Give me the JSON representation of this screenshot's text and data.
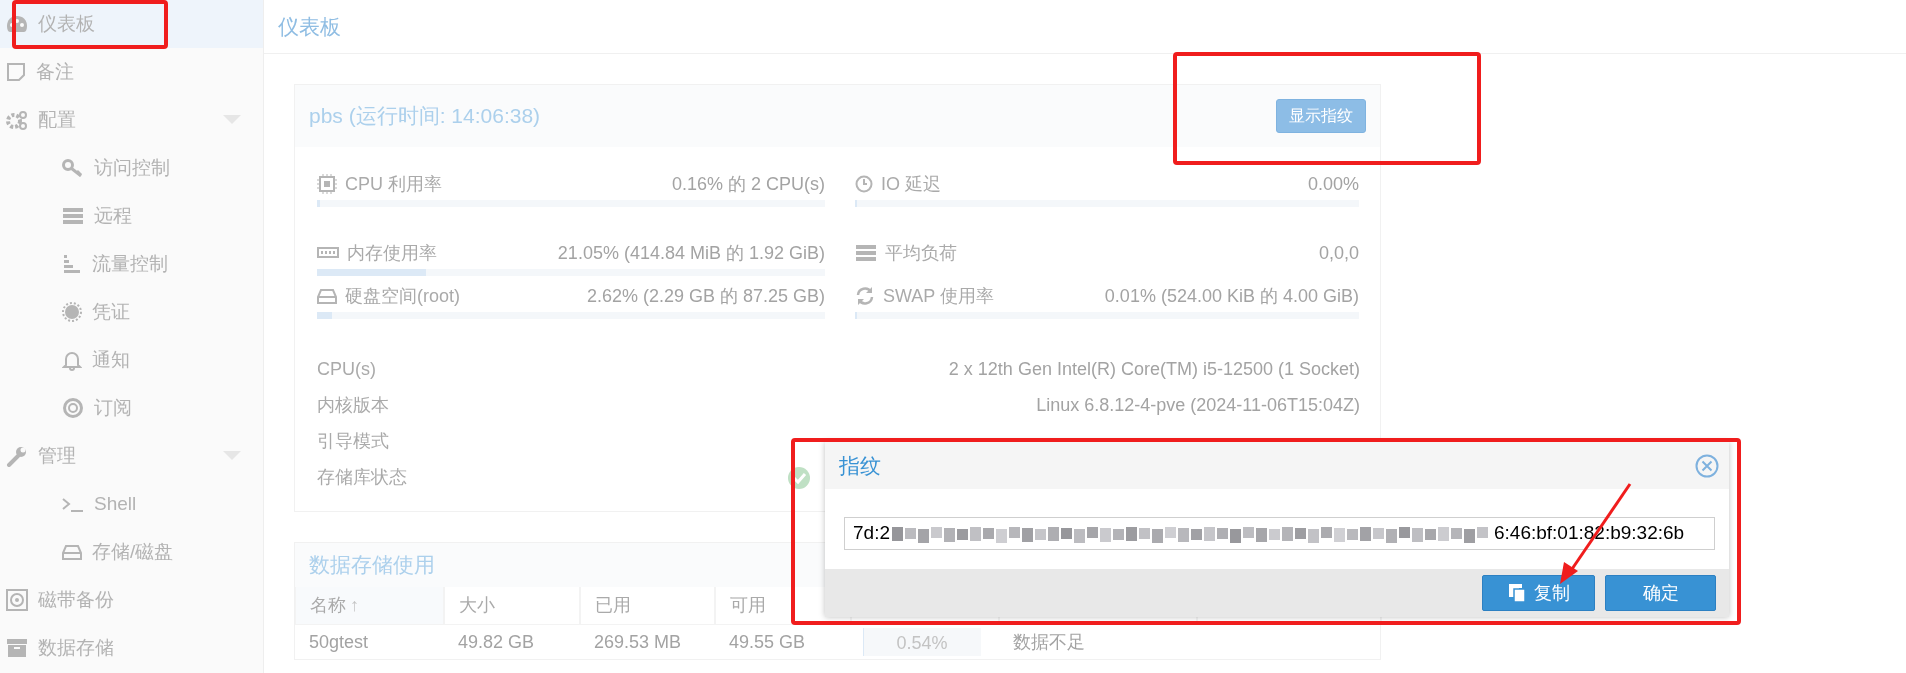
{
  "sidebar": {
    "items": [
      {
        "label": "仪表板",
        "selected": true
      },
      {
        "label": "备注",
        "selected": false
      },
      {
        "label": "配置",
        "selected": false,
        "expanded": true,
        "children": [
          {
            "label": "访问控制",
            "selected": false
          },
          {
            "label": "远程",
            "selected": false
          },
          {
            "label": "流量控制",
            "selected": false
          },
          {
            "label": "凭证",
            "selected": false
          },
          {
            "label": "通知",
            "selected": false
          },
          {
            "label": "订阅",
            "selected": false
          }
        ]
      },
      {
        "label": "管理",
        "selected": false,
        "expanded": true,
        "children": [
          {
            "label": "Shell",
            "selected": false
          },
          {
            "label": "存储/磁盘",
            "selected": false
          }
        ]
      },
      {
        "label": "磁带备份",
        "selected": false
      },
      {
        "label": "数据存储",
        "selected": false
      }
    ]
  },
  "header": {
    "title": "仪表板"
  },
  "status_card": {
    "title": "pbs (运行时间: 14:06:38)",
    "button": "显示指纹",
    "metrics": [
      {
        "kind": "meter",
        "label": "CPU 利用率",
        "value": "0.16% 的 2 CPU(s)",
        "level": 0.0016
      },
      {
        "kind": "meter",
        "label": "IO 延迟",
        "value": "0.00%",
        "level": 0
      },
      {
        "kind": "meter",
        "label": "内存使用率",
        "value": "21.05% (414.84 MiB 的 1.92 GiB)",
        "level": 0.2105
      },
      {
        "kind": "plain",
        "label": "平均负荷",
        "value": "0,0,0"
      },
      {
        "kind": "meter",
        "label": "硬盘空间(root)",
        "value": "2.62% (2.29 GB 的 87.25 GB)",
        "level": 0.0262
      },
      {
        "kind": "meter",
        "label": "SWAP 使用率",
        "value": "0.01% (524.00 KiB 的 4.00 GiB)",
        "level": 0.0001
      }
    ],
    "info": [
      {
        "label": "CPU(s)",
        "value": "2 x 12th Gen Intel(R) Core(TM) i5-12500 (1 Socket)"
      },
      {
        "label": "内核版本",
        "value": "Linux 6.8.12-4-pve (2024-11-06T15:04Z)"
      },
      {
        "label": "引导模式"
      },
      {
        "label": "存储库状态",
        "status_ok": true
      }
    ]
  },
  "datastore_card": {
    "title": "数据存储使用",
    "columns": [
      {
        "label": "名称",
        "sort_arrow": "↑"
      },
      {
        "label": "大小"
      },
      {
        "label": "已用"
      },
      {
        "label": "可用"
      },
      {},
      {},
      {}
    ],
    "rows": [
      {
        "cells": [
          "50gtest",
          "49.82 GB",
          "269.53 MB",
          "49.55 GB"
        ],
        "usage": {
          "level": 0.0054,
          "reading": "0.54%"
        },
        "estimate": "数据不足"
      }
    ]
  },
  "dialog": {
    "title": "指纹",
    "value_start": "7d:2",
    "value_end": "6:46:bf:01:82:b9:32:6b",
    "redacted": true,
    "buttons": [
      {
        "label": "复制",
        "kind": "copy"
      },
      {
        "label": "确定",
        "kind": "plain"
      }
    ]
  },
  "annotations": [
    {
      "kind": "box"
    },
    {
      "kind": "box"
    },
    {
      "kind": "box"
    },
    {
      "kind": "arrow"
    }
  ]
}
